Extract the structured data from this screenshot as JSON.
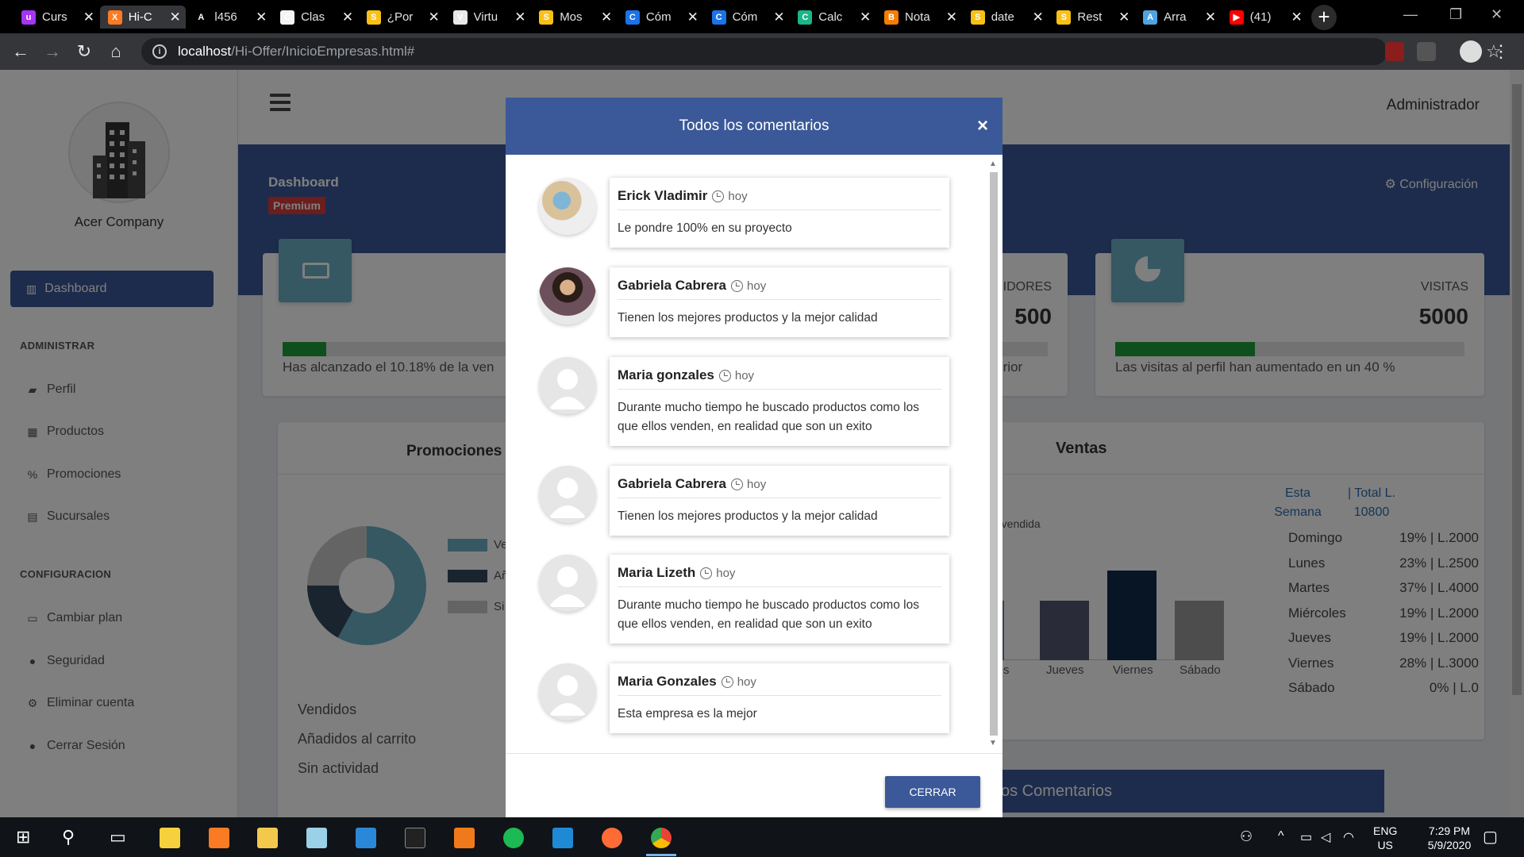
{
  "browser": {
    "tabs": [
      {
        "label": "Curs",
        "icon": "udemy-icon",
        "color": "#a435f0",
        "glyph": "u"
      },
      {
        "label": "Hi-C",
        "icon": "xampp-icon",
        "color": "#fb7a24",
        "glyph": "X",
        "active": true
      },
      {
        "label": "l456",
        "icon": "font-a-icon",
        "color": "#000000",
        "glyph": "A"
      },
      {
        "label": "Clas",
        "icon": "classroom-icon",
        "color": "#f4f4f4",
        "glyph": "C"
      },
      {
        "label": "¿Por",
        "icon": "slides-icon",
        "color": "#f9c116",
        "glyph": "S"
      },
      {
        "label": "Virtu",
        "icon": "video-icon",
        "color": "#e8e8e8",
        "glyph": "V"
      },
      {
        "label": "Mos",
        "icon": "slides-icon",
        "color": "#f9c116",
        "glyph": "S"
      },
      {
        "label": "Cóm",
        "icon": "shield-icon",
        "color": "#1a73e8",
        "glyph": "C"
      },
      {
        "label": "Cóm",
        "icon": "shield-icon",
        "color": "#1a73e8",
        "glyph": "C"
      },
      {
        "label": "Calc",
        "icon": "calculator-icon",
        "color": "#1cb48b",
        "glyph": "C"
      },
      {
        "label": "Nota",
        "icon": "blogger-icon",
        "color": "#f57d00",
        "glyph": "B"
      },
      {
        "label": "date",
        "icon": "slides-icon",
        "color": "#f9c116",
        "glyph": "S"
      },
      {
        "label": "Rest",
        "icon": "slides-icon",
        "color": "#f9c116",
        "glyph": "S"
      },
      {
        "label": "Arra",
        "icon": "image-icon",
        "color": "#4fa3e0",
        "glyph": "A"
      },
      {
        "label": "(41)",
        "icon": "youtube-icon",
        "color": "#ff0000",
        "glyph": "▶"
      }
    ],
    "url_host": "localhost",
    "url_path": "/Hi-Offer/InicioEmpresas.html#"
  },
  "sidebar": {
    "company": "Acer Company",
    "active_item": "Dashboard",
    "sections": [
      {
        "title": "ADMINISTRAR",
        "items": [
          "Perfil",
          "Productos",
          "Promociones",
          "Sucursales"
        ]
      },
      {
        "title": "CONFIGURACION",
        "items": [
          "Cambiar plan",
          "Seguridad",
          "Eliminar cuenta",
          "Cerrar Sesión"
        ]
      }
    ]
  },
  "header": {
    "user": "Administrador"
  },
  "banner": {
    "title": "Dashboard",
    "badge": "Premium",
    "config": "Configuración"
  },
  "stats": [
    {
      "label": "",
      "value": "",
      "progress": 0.1018,
      "caption": "Has alcanzado el 10.18% de la ven"
    },
    {
      "label": "IDORES",
      "value": "500",
      "progress": 0,
      "caption": "nterior"
    },
    {
      "label": "VISITAS",
      "value": "5000",
      "progress": 0.4,
      "caption": "Las visitas al perfil han aumentado en un 40 %"
    }
  ],
  "promociones": {
    "title": "Promociones",
    "legend": [
      "Ve",
      "Añ",
      "Si"
    ],
    "labels": [
      "Vendidos",
      "Añadidos al carrito",
      "Sin actividad"
    ],
    "colors": [
      "#6ab1c7",
      "#34495e",
      "#c8c8c8"
    ],
    "shares": [
      0.58,
      0.17,
      0.25
    ]
  },
  "ventas": {
    "title": "Ventas",
    "chart_caption": "d vendida",
    "col_headers": [
      "Esta Semana",
      "| Total L. 10800"
    ],
    "rows": [
      {
        "day": "Domingo",
        "value": "19% | L.2000"
      },
      {
        "day": "Lunes",
        "value": "23% | L.2500"
      },
      {
        "day": "Martes",
        "value": "37% | L.4000"
      },
      {
        "day": "Miércoles",
        "value": "19% | L.2000"
      },
      {
        "day": "Jueves",
        "value": "19% | L.2000"
      },
      {
        "day": "Viernes",
        "value": "28% | L.3000"
      },
      {
        "day": "Sábado",
        "value": "0% | L.0"
      }
    ],
    "bar_labels": [
      "oles",
      "Jueves",
      "Viernes",
      "Sábado"
    ]
  },
  "comments_header": "os Comentarios",
  "modal": {
    "title": "Todos los comentarios",
    "close_symbol": "×",
    "button": "CERRAR",
    "comments": [
      {
        "name": "Erick Vladimir",
        "time": "hoy",
        "text": "Le pondre 100% en su proyecto",
        "avatar": "photo-illustration"
      },
      {
        "name": "Gabriela Cabrera",
        "time": "hoy",
        "text": "Tienen los mejores productos y la mejor calidad",
        "avatar": "photo-woman"
      },
      {
        "name": "Maria gonzales",
        "time": "hoy",
        "text": "Durante mucho tiempo he buscado productos como los que ellos venden, en realidad que son un exito",
        "avatar": "default"
      },
      {
        "name": "Gabriela Cabrera",
        "time": "hoy",
        "text": "Tienen los mejores productos y la mejor calidad",
        "avatar": "default"
      },
      {
        "name": "Maria Lizeth",
        "time": "hoy",
        "text": "Durante mucho tiempo he buscado productos como los que ellos venden, en realidad que son un exito",
        "avatar": "default"
      },
      {
        "name": "Maria Gonzales",
        "time": "hoy",
        "text": "Esta empresa es la mejor",
        "avatar": "default"
      }
    ]
  },
  "taskbar": {
    "lang": "ENG",
    "region": "US",
    "time": "7:29 PM",
    "date": "5/9/2020"
  }
}
